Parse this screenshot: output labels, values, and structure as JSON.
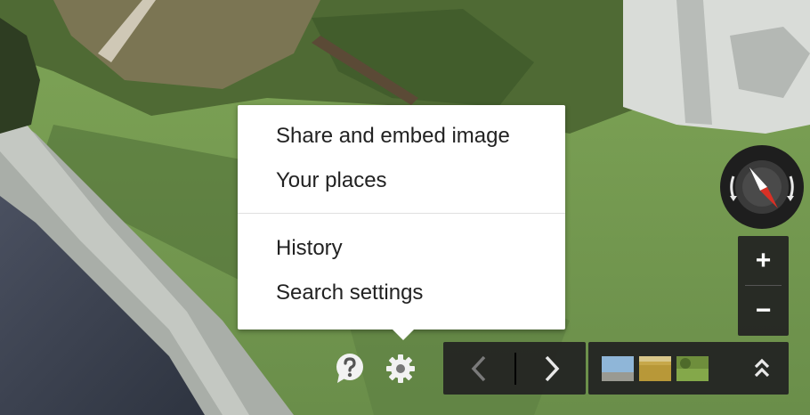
{
  "menu": {
    "items": [
      {
        "label": "Share and embed image"
      },
      {
        "label": "Your places"
      },
      {
        "label": "History"
      },
      {
        "label": "Search settings"
      }
    ]
  },
  "controls": {
    "compass_icon": "compass-icon",
    "zoom_in_label": "+",
    "zoom_out_label": "−",
    "help_icon": "help-icon",
    "settings_icon": "gear-icon",
    "prev_icon": "chevron-left-icon",
    "next_icon": "chevron-right-icon",
    "expand_icon": "double-chevron-up-icon"
  },
  "colors": {
    "menu_bg": "#ffffff",
    "control_bg": "#222222",
    "compass_needle": "#d93025",
    "grass": "#6e9a48",
    "road": "#3a4150"
  }
}
